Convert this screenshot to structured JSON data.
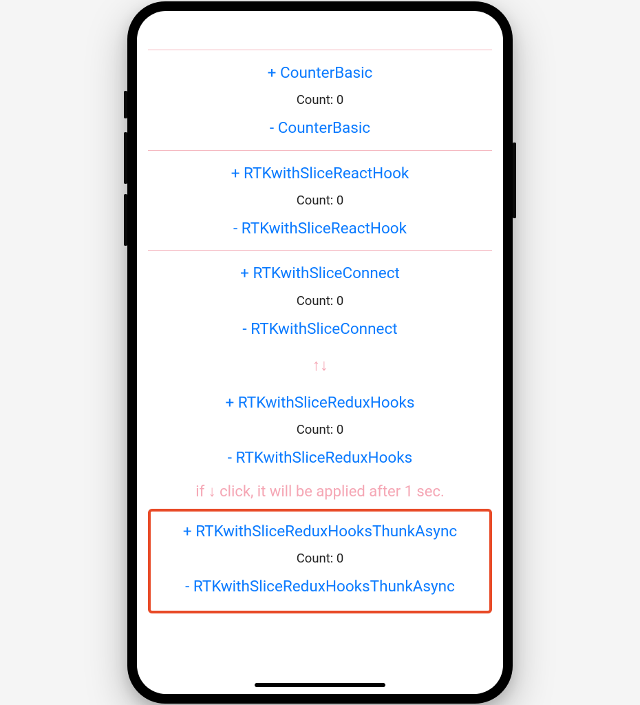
{
  "counters": {
    "basic": {
      "inc": "+ CounterBasic",
      "count": "Count: 0",
      "dec": "- CounterBasic"
    },
    "sliceReactHook": {
      "inc": "+ RTKwithSliceReactHook",
      "count": "Count: 0",
      "dec": "- RTKwithSliceReactHook"
    },
    "sliceConnect": {
      "inc": "+ RTKwithSliceConnect",
      "count": "Count: 0",
      "dec": "- RTKwithSliceConnect"
    },
    "sliceReduxHooks": {
      "inc": "+ RTKwithSliceReduxHooks",
      "count": "Count: 0",
      "dec": "- RTKwithSliceReduxHooks"
    },
    "sliceReduxHooksThunkAsync": {
      "inc": "+ RTKwithSliceReduxHooksThunkAsync",
      "count": "Count: 0",
      "dec": "- RTKwithSliceReduxHooksThunkAsync"
    }
  },
  "arrows": "↑↓",
  "asyncNote": "if ↓ click, it will be applied after 1 sec."
}
